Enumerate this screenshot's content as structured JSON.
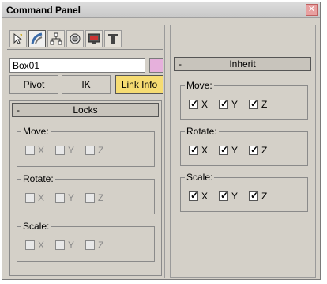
{
  "window": {
    "title": "Command Panel",
    "close_glyph": "✕"
  },
  "tabs": [
    {
      "icon": "create-icon"
    },
    {
      "icon": "modify-icon"
    },
    {
      "icon": "hierarchy-icon"
    },
    {
      "icon": "motion-icon"
    },
    {
      "icon": "display-icon"
    },
    {
      "icon": "utilities-icon"
    }
  ],
  "object": {
    "name": "Box01",
    "color": "#e6b0dc"
  },
  "buttons": {
    "pivot": "Pivot",
    "ik": "IK",
    "link_info": "Link Info"
  },
  "locks": {
    "toggle": "-",
    "title": "Locks",
    "move": {
      "label": "Move:",
      "x": "X",
      "y": "Y",
      "z": "Z"
    },
    "rotate": {
      "label": "Rotate:",
      "x": "X",
      "y": "Y",
      "z": "Z"
    },
    "scale": {
      "label": "Scale:",
      "x": "X",
      "y": "Y",
      "z": "Z"
    }
  },
  "inherit": {
    "toggle": "-",
    "title": "Inherit",
    "move": {
      "label": "Move:",
      "x": "X",
      "y": "Y",
      "z": "Z"
    },
    "rotate": {
      "label": "Rotate:",
      "x": "X",
      "y": "Y",
      "z": "Z"
    },
    "scale": {
      "label": "Scale:",
      "x": "X",
      "y": "Y",
      "z": "Z"
    }
  }
}
